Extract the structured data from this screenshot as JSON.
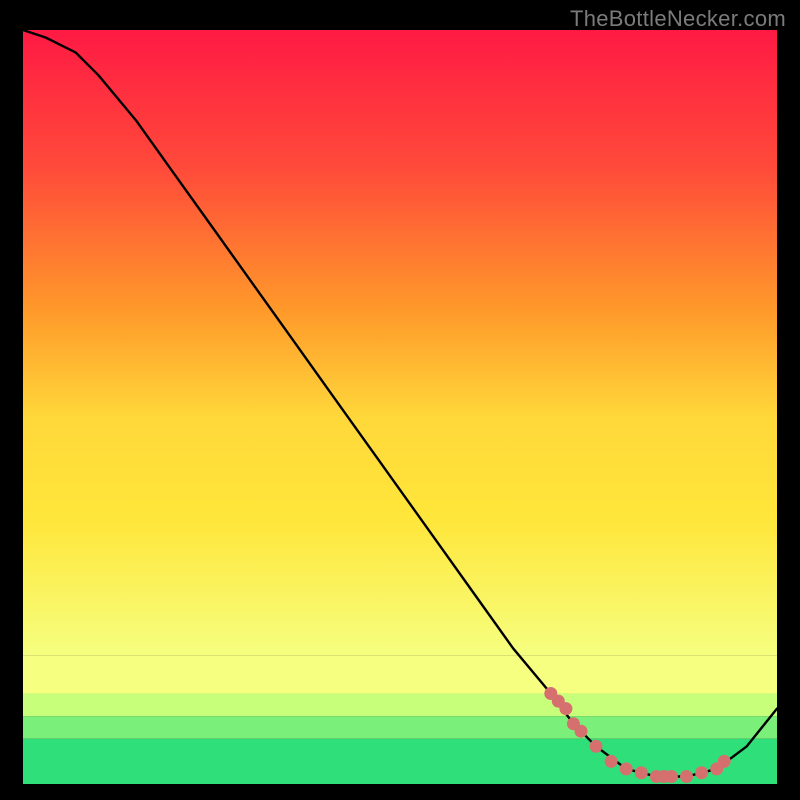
{
  "watermark": "TheBottleNecker.com",
  "colors": {
    "bg": "#000000",
    "watermark": "#7b7b7b",
    "curve": "#000000",
    "markers": "#d6706e",
    "grad_top": "#ff1a44",
    "grad_mid1": "#ff8a2a",
    "grad_mid2": "#ffe63a",
    "grad_low": "#f6ff80",
    "grad_green1": "#aaff7a",
    "grad_green2": "#2fe07a"
  },
  "chart_data": {
    "type": "line",
    "title": "",
    "xlabel": "",
    "ylabel": "",
    "xlim": [
      0,
      100
    ],
    "ylim": [
      0,
      100
    ],
    "series": [
      {
        "name": "curve",
        "x": [
          0,
          3,
          7,
          10,
          15,
          20,
          25,
          30,
          35,
          40,
          45,
          50,
          55,
          60,
          65,
          70,
          73,
          76,
          80,
          84,
          88,
          92,
          96,
          100
        ],
        "y": [
          100,
          99,
          97,
          94,
          88,
          81,
          74,
          67,
          60,
          53,
          46,
          39,
          32,
          25,
          18,
          12,
          8,
          5,
          2,
          1,
          1,
          2,
          5,
          10
        ]
      }
    ],
    "markers": {
      "name": "highlight-points",
      "x": [
        70,
        71,
        72,
        73,
        74,
        76,
        78,
        80,
        82,
        84,
        85,
        86,
        88,
        90,
        92,
        93
      ],
      "y": [
        12,
        11,
        10,
        8,
        7,
        5,
        3,
        2,
        1.5,
        1,
        1,
        1,
        1,
        1.5,
        2,
        3
      ]
    },
    "gradient_bands": [
      {
        "y0": 0,
        "y1": 6,
        "color": "#2fe07a"
      },
      {
        "y0": 6,
        "y1": 9,
        "color": "#7af07a"
      },
      {
        "y0": 9,
        "y1": 12,
        "color": "#c8ff7a"
      },
      {
        "y0": 12,
        "y1": 17,
        "color": "#f6ff80"
      },
      {
        "y0": 17,
        "y1": 100,
        "gradient": true
      }
    ]
  }
}
